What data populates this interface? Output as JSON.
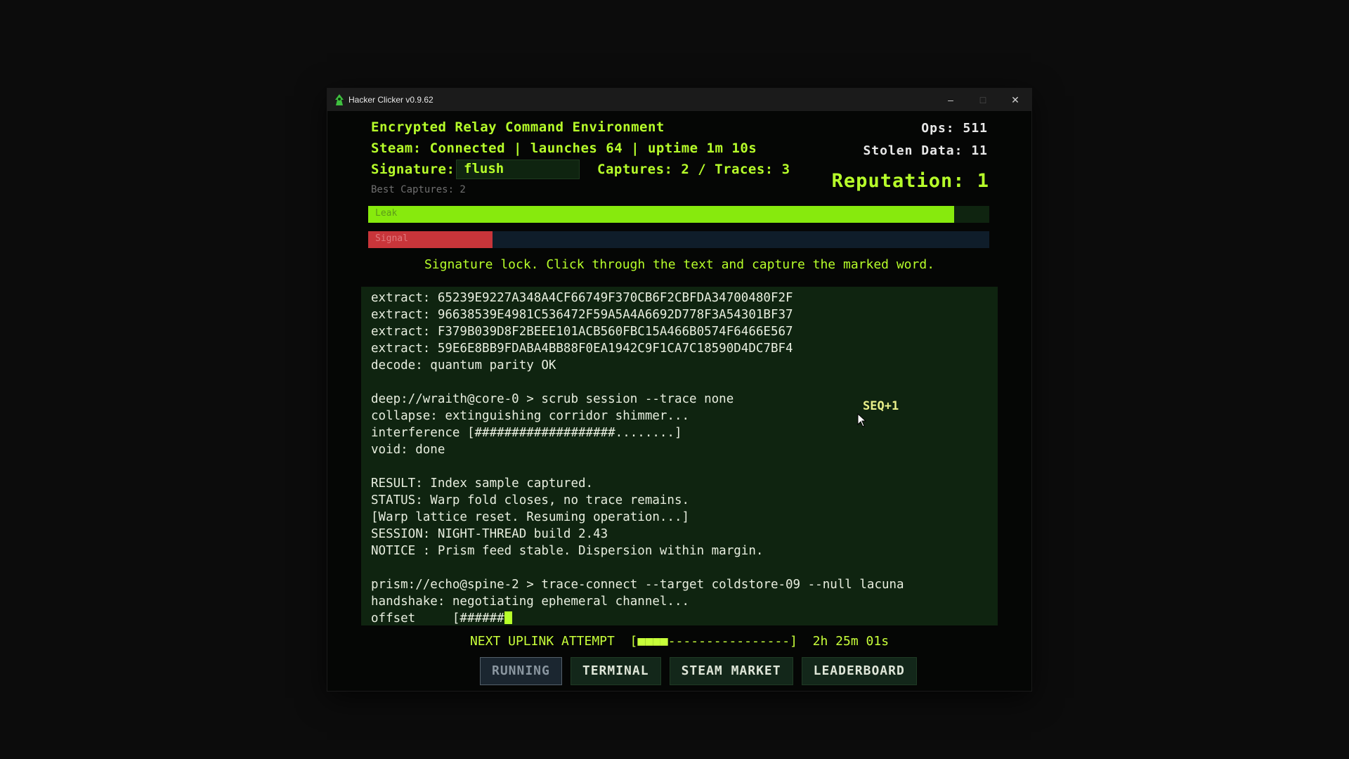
{
  "window": {
    "title": "Hacker Clicker v0.9.62",
    "minimize": "–",
    "maximize": "□",
    "close": "✕"
  },
  "header": {
    "environment": "Encrypted Relay Command Environment",
    "status_line": "Steam: Connected | launches 64 | uptime 1m 10s",
    "signature_label": "Signature:",
    "signature_value": "flush",
    "captures_traces": "Captures: 2 / Traces: 3",
    "best_captures": "Best Captures: 2",
    "ops": "Ops: 511",
    "stolen_data": "Stolen Data: 11",
    "reputation": "Reputation: 1"
  },
  "bars": {
    "leak": {
      "label": "Leak",
      "value": 0.944,
      "color": "#87ea0d",
      "track": "#0f2410"
    },
    "signal": {
      "label": "Signal",
      "value": 0.2,
      "color": "#c8353a",
      "track": "#0f1d2a"
    }
  },
  "hint": "Signature lock. Click through the text and capture the marked word.",
  "terminal": {
    "lines": [
      "extract: 65239E9227A348A4CF66749F370CB6F2CBFDA34700480F2F",
      "extract: 96638539E4981C536472F59A5A4A6692D778F3A54301BF37",
      "extract: F379B039D8F2BEEE101ACB560FBC15A466B0574F6466E567",
      "extract: 59E6E8BB9FDABA4BB88F0EA1942C9F1CA7C18590D4DC7BF4",
      "decode: quantum parity OK",
      "",
      "deep://wraith@core-0 > scrub session --trace none",
      "collapse: extinguishing corridor shimmer...",
      "interference [###################........]",
      "void: done",
      "",
      "RESULT: Index sample captured.",
      "STATUS: Warp fold closes, no trace remains.",
      "[Warp lattice reset. Resuming operation...]",
      "SESSION: NIGHT-THREAD build 2.43",
      "NOTICE : Prism feed stable. Dispersion within margin.",
      "",
      "prism://echo@spine-2 > trace-connect --target coldstore-09 --null lacuna",
      "handshake: negotiating ephemeral channel...",
      "offset     [######"
    ],
    "floating": "SEQ+1"
  },
  "uplink": {
    "label": "NEXT UPLINK ATTEMPT",
    "bar_open": "[",
    "bar_blocks": "■■■■",
    "bar_rest": "----------------",
    "bar_close": "]",
    "countdown": "2h 25m 01s"
  },
  "tabs": [
    {
      "label": "RUNNING",
      "active": true
    },
    {
      "label": "TERMINAL",
      "active": false
    },
    {
      "label": "STEAM MARKET",
      "active": false
    },
    {
      "label": "LEADERBOARD",
      "active": false
    }
  ]
}
